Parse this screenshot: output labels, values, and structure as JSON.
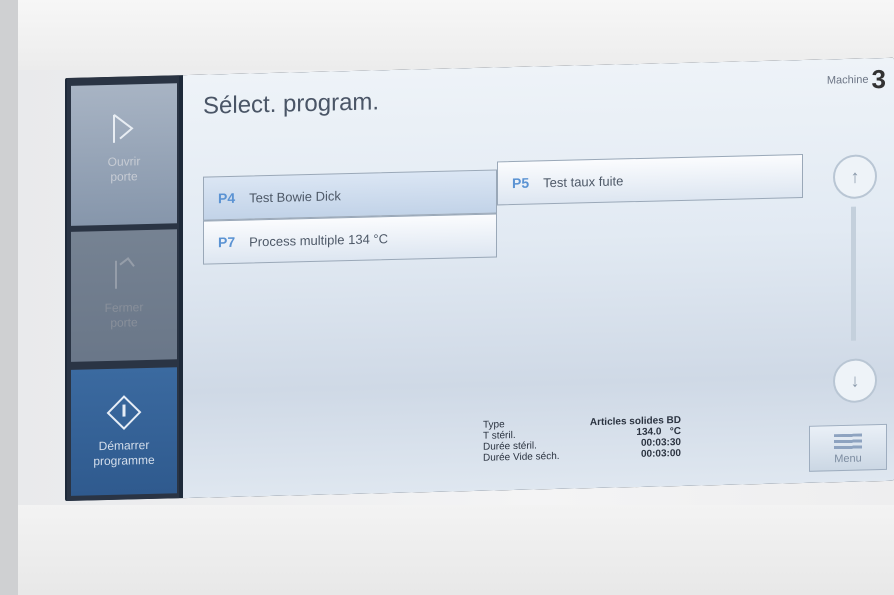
{
  "screen": {
    "title": "Sélect. program.",
    "machine_label": "Machine",
    "machine_number": "3"
  },
  "sidebar": {
    "open_door_label": "Ouvrir\nporte",
    "close_door_label": "Fermer\nporte",
    "start_program_label": "Démarrer\nprogramme"
  },
  "programs": [
    {
      "code": "P4",
      "name": "Test Bowie Dick",
      "selected": true
    },
    {
      "code": "P5",
      "name": "Test taux fuite",
      "selected": false
    },
    {
      "code": "P7",
      "name": "Process multiple 134 °C",
      "selected": false
    }
  ],
  "info": {
    "type_label": "Type",
    "type_value": "Articles solides BD",
    "temp_label": "T stéril.",
    "temp_value": "134.0   °C",
    "ster_time_label": "Durée stéril.",
    "ster_time_value": "00:03:30",
    "dry_time_label": "Durée Vide séch.",
    "dry_time_value": "00:03:00"
  },
  "menu": {
    "label": "Menu"
  },
  "icons": {
    "open_door": "open-door-icon",
    "close_door": "close-door-icon",
    "start": "start-diamond-icon",
    "up": "arrow-up-icon",
    "down": "arrow-down-icon",
    "menu": "menu-bars-icon"
  },
  "colors": {
    "program_code": "#5b93d3",
    "start_button": "#3b6aa0",
    "sidebar": "#2a3444"
  }
}
